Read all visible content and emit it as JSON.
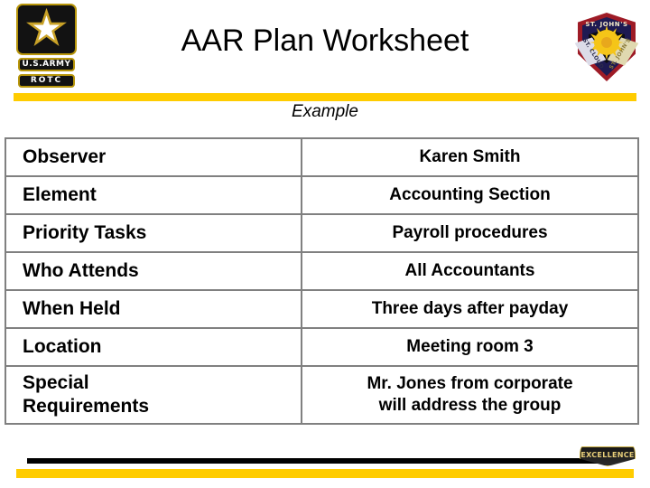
{
  "header": {
    "title": "AAR Plan Worksheet",
    "subtitle": "Example",
    "accent_yellow": "#ffcc00",
    "army_logo": {
      "name": "us-army-rotc-logo",
      "line1": "U.S.ARMY",
      "line2": "ROTC"
    },
    "crest": {
      "name": "st-johns-st-cloud-crest",
      "top_text": "ST. JOHN'S",
      "left_text": "ST. CLOUD",
      "right_text": "ST. JOHN'S"
    }
  },
  "worksheet": {
    "rows": [
      {
        "label": "Observer",
        "value": "Karen Smith",
        "tall": false
      },
      {
        "label": "Element",
        "value": "Accounting Section",
        "tall": false
      },
      {
        "label": "Priority Tasks",
        "value": "Payroll procedures",
        "tall": false
      },
      {
        "label": "Who Attends",
        "value": "All Accountants",
        "tall": false
      },
      {
        "label": "When Held",
        "value": "Three days after payday",
        "tall": false
      },
      {
        "label": "Location",
        "value": "Meeting room 3",
        "tall": false
      },
      {
        "label": "Special Requirements",
        "label_line1": "Special",
        "label_line2": "Requirements",
        "value_line1": "Mr. Jones from corporate",
        "value_line2": "will address the group",
        "tall": true
      }
    ]
  },
  "footer": {
    "excellence_label": "EXCELLENCE",
    "black_rule_color": "#000000",
    "yellow_rule_color": "#ffcc00"
  }
}
